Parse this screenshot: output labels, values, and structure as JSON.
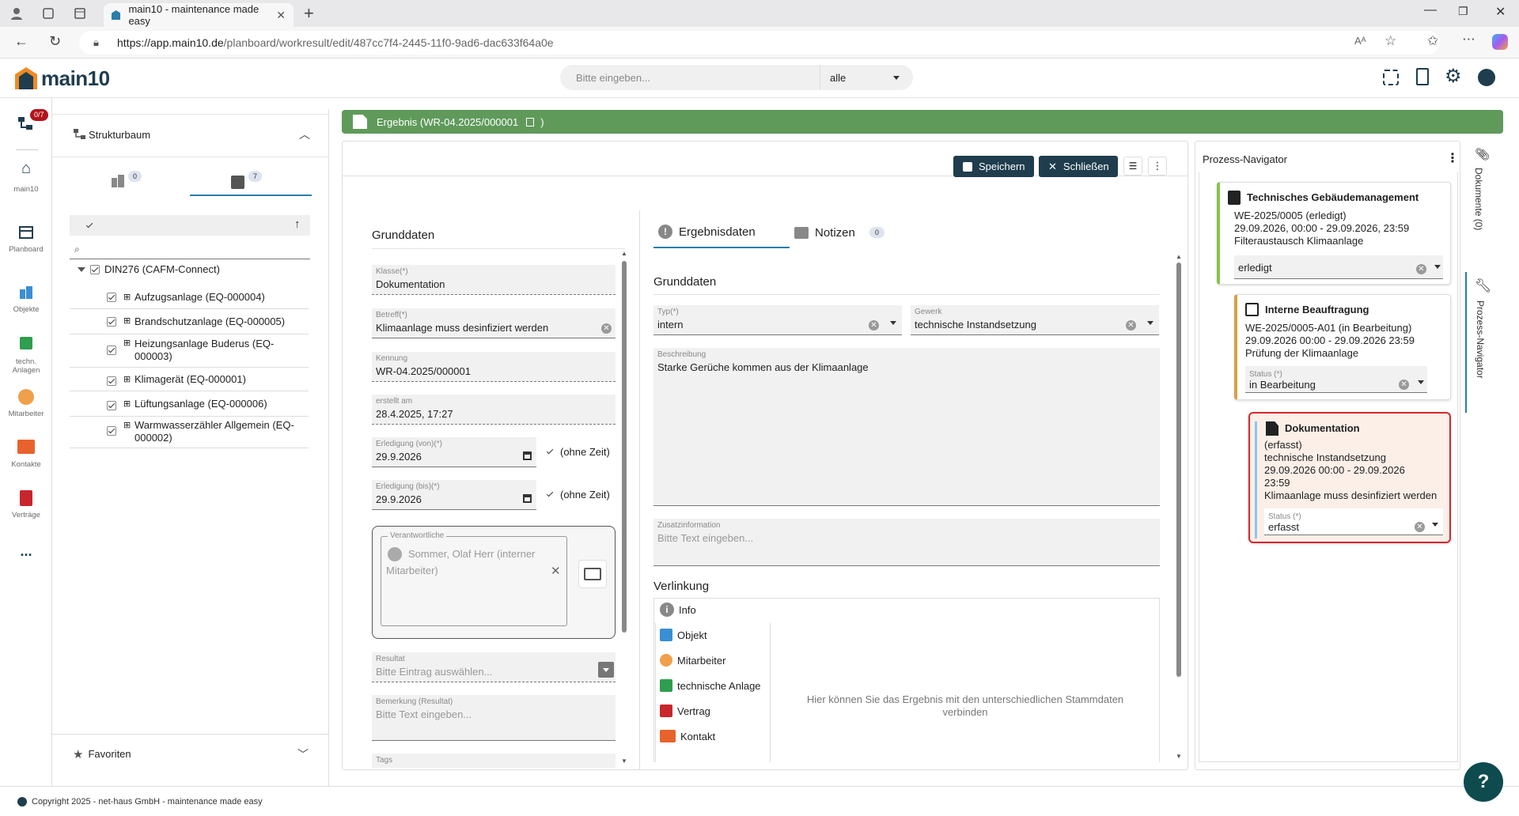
{
  "browser": {
    "tab_title": "main10 - maintenance made easy",
    "url_host": "https://app.main10.de",
    "url_path": "/planboard/workresult/edit/487cc7f4-2445-11f0-9ad6-dac633f64a0e"
  },
  "header": {
    "logo": "main10",
    "search_placeholder": "Bitte eingeben...",
    "scope_select": "alle"
  },
  "nav": {
    "badge": "0/7",
    "items": [
      "main10",
      "Planboard",
      "Objekte",
      "techn. Anlagen",
      "Mitarbeiter",
      "Kontakte",
      "Verträge"
    ],
    "more": "..."
  },
  "structure": {
    "title": "Strukturbaum",
    "tab_objects_count": "0",
    "tab_assets_count": "7",
    "root": "DIN276 (CAFM-Connect)",
    "items": [
      "Aufzugsanlage (EQ-000004)",
      "Brandschutzanlage (EQ-000005)",
      "Heizungsanlage Buderus (EQ-",
      "000003)",
      "Klimagerät (EQ-000001)",
      "Lüftungsanlage (EQ-000006)",
      "Warmwasserzähler Allgemein (EQ-",
      "000002)"
    ],
    "favorites": "Favoriten"
  },
  "result": {
    "banner": "Ergebnis (WR-04.2025/000001",
    "banner_close": ")",
    "save": "Speichern",
    "close": "Schließen"
  },
  "basic": {
    "title": "Grunddaten",
    "klasse_label": "Klasse(*)",
    "klasse": "Dokumentation",
    "betreff_label": "Betreff(*)",
    "betreff": "Klimaanlage muss desinfiziert werden",
    "kennung_label": "Kennung",
    "kennung": "WR-04.2025/000001",
    "erstellt_label": "erstellt am",
    "erstellt": "28.4.2025, 17:27",
    "von_label": "Erledigung (von)(*)",
    "von": "29.9.2026",
    "bis_label": "Erledigung (bis)(*)",
    "bis": "29.9.2026",
    "ohne_zeit": "(ohne Zeit)",
    "verantwortliche_label": "Verantwortliche",
    "verantwortliche": "Sommer, Olaf Herr (interner",
    "verantwortliche2": "Mitarbeiter)",
    "resultat_label": "Resultat",
    "resultat_ph": "Bitte Eintrag auswählen...",
    "bemerkung_label": "Bemerkung (Resultat)",
    "bemerkung_ph": "Bitte Text eingeben...",
    "tags_label": "Tags"
  },
  "details": {
    "tab_ergebnis": "Ergebnisdaten",
    "tab_notizen": "Notizen",
    "notizen_count": "0",
    "section": "Grunddaten",
    "typ_label": "Typ(*)",
    "typ": "intern",
    "gewerk_label": "Gewerk",
    "gewerk": "technische Instandsetzung",
    "beschreibung_label": "Beschreibung",
    "beschreibung": "Starke Gerüche kommen aus der Klimaanlage",
    "zusatz_label": "Zusatzinformation",
    "zusatz_ph": "Bitte Text eingeben...",
    "verlinkung": "Verlinkung",
    "links": [
      "Info",
      "Objekt",
      "Mitarbeiter",
      "technische Anlage",
      "Vertrag",
      "Kontakt"
    ],
    "hint1": "Hier können Sie das Ergebnis mit den unterschiedlichen Stammdaten",
    "hint2": "verbinden"
  },
  "process": {
    "title": "Prozess-Navigator",
    "cards": [
      {
        "title": "Technisches Gebäudemanagement",
        "l1": "WE-2025/0005 (erledigt)",
        "l2": "29.09.2026, 00:00 - 29.09.2026, 23:59",
        "l3": "Filteraustausch Klimaanlage",
        "status": "erledigt"
      },
      {
        "title": "Interne Beauftragung",
        "l1": "WE-2025/0005-A01 (in Bearbeitung)",
        "l2": "29.09.2026 00:00 - 29.09.2026 23:59",
        "l3": "Prüfung der Klimaanlage",
        "status_label": "Status (*)",
        "status": "in Bearbeitung"
      },
      {
        "title": "Dokumentation",
        "l1": "(erfasst)",
        "l2": "technische Instandsetzung",
        "l3": "29.09.2026 00:00 - 29.09.2026",
        "l4": "23:59",
        "l5": "Klimaanlage muss desinfiziert werden",
        "status_label": "Status (*)",
        "status": "erfasst"
      }
    ],
    "side_docs": "Dokumente (0)",
    "side_nav": "Prozess-Navigator"
  },
  "footer": "Copyright 2025 - net-haus GmbH - maintenance made easy",
  "colors": {
    "brand_green": "#5f9a5b",
    "dark_teal": "#1f3d4d",
    "accent_blue": "#2a7ea8"
  }
}
